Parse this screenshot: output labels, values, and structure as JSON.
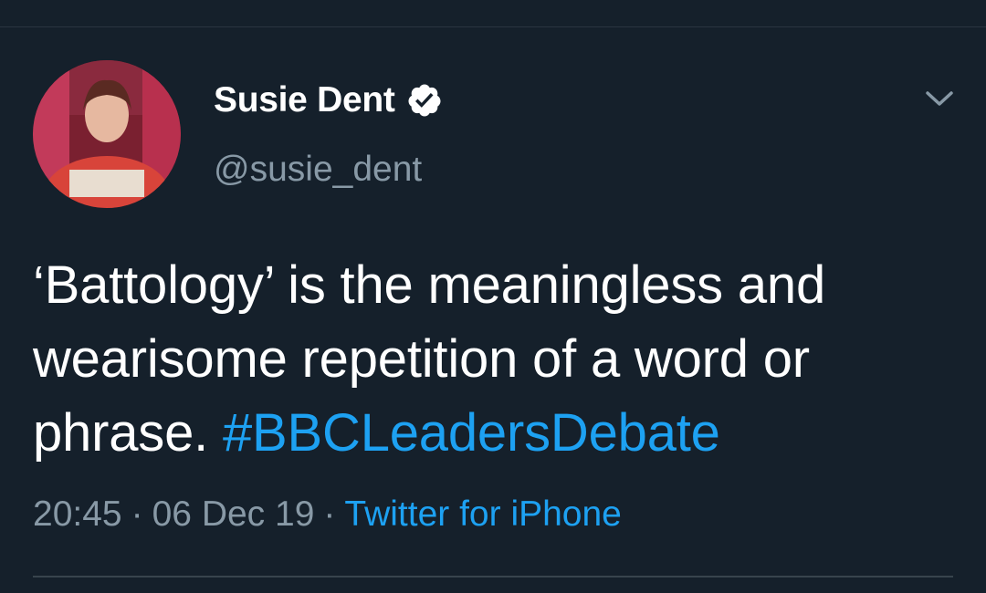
{
  "author": {
    "name": "Susie Dent",
    "handle": "@susie_dent",
    "verified": true
  },
  "tweet": {
    "text_plain": "‘Battology’ is the meaningless and wearisome repetition of a word or phrase.",
    "hashtag": "#BBCLeadersDebate"
  },
  "meta": {
    "time": "20:45",
    "separator": "·",
    "date": "06 Dec 19",
    "source": "Twitter for iPhone"
  },
  "colors": {
    "background": "#15202b",
    "text": "#ffffff",
    "secondary_text": "#8899a6",
    "link": "#1da1f2",
    "divider": "#38444d"
  },
  "icons": {
    "verified": "verified-badge-icon",
    "menu": "chevron-down-icon"
  }
}
